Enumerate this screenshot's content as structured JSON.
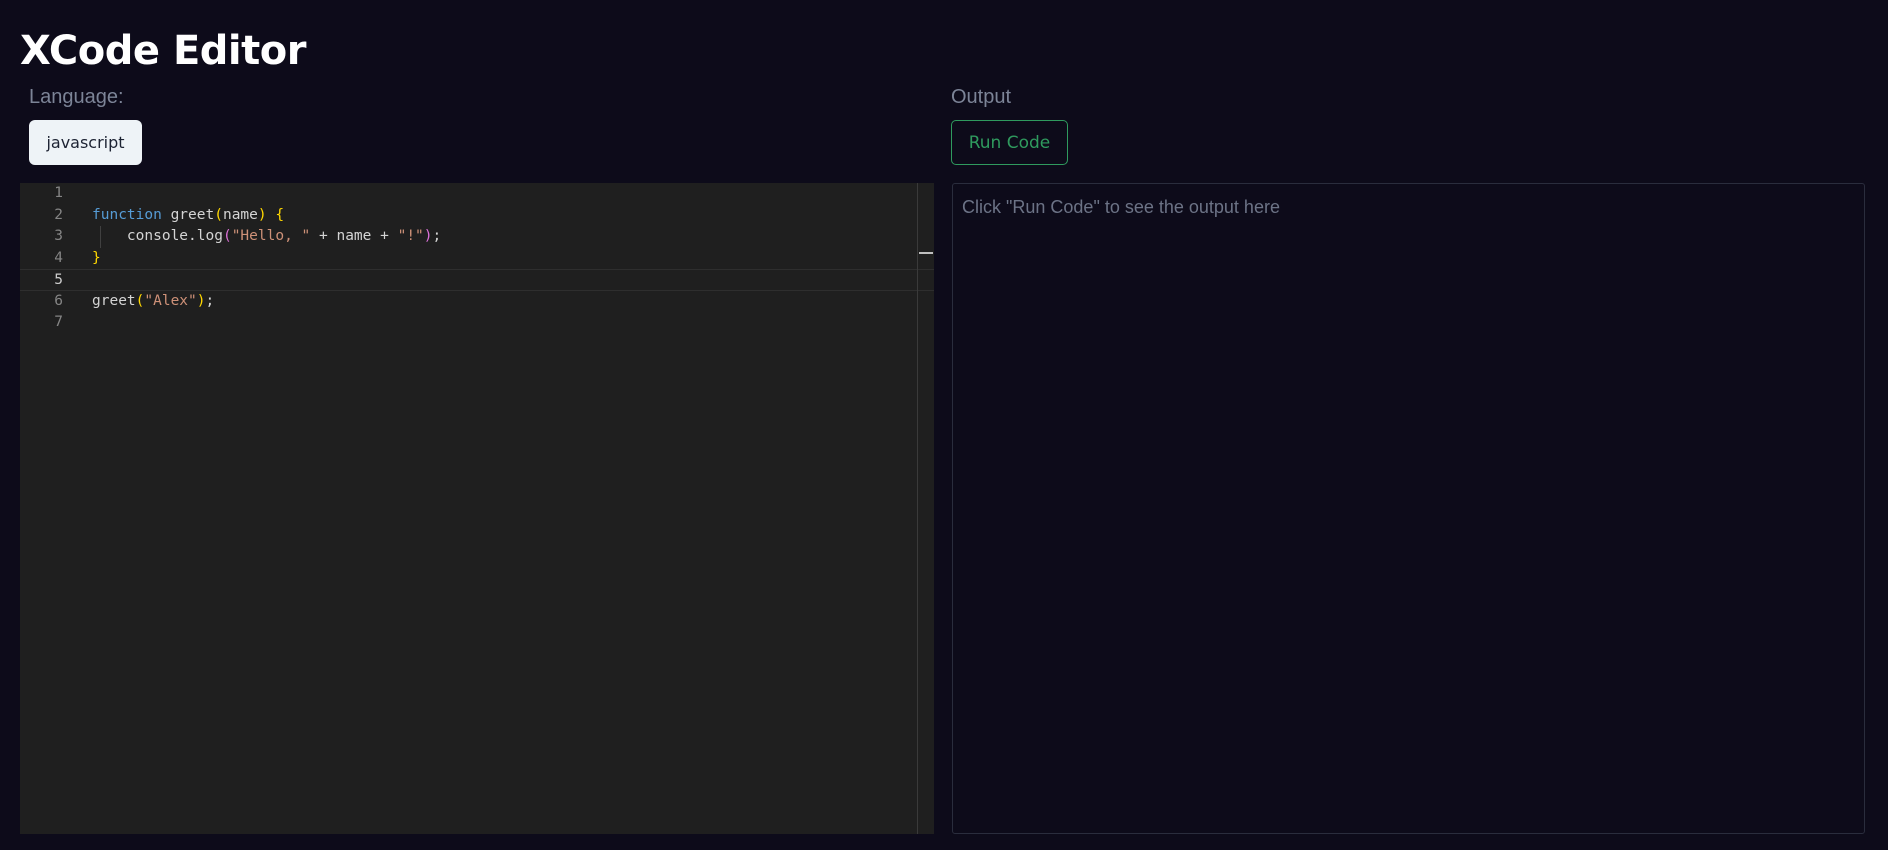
{
  "app": {
    "title": "XCode Editor"
  },
  "language": {
    "label": "Language:",
    "selected": "javascript"
  },
  "output": {
    "label": "Output",
    "run_button": "Run Code",
    "placeholder": "Click \"Run Code\" to see the output here"
  },
  "editor": {
    "active_line": 5,
    "line_numbers": [
      "1",
      "2",
      "3",
      "4",
      "5",
      "6",
      "7"
    ],
    "lines": [
      "",
      "function greet(name) {",
      "    console.log(\"Hello, \" + name + \"!\");",
      "}",
      "",
      "greet(\"Alex\");",
      ""
    ]
  },
  "colors": {
    "background": "#0d0b1a",
    "editor_background": "#1f1f1f",
    "run_button_accent": "#2f9a5e",
    "language_button_bg": "#eef3f7"
  }
}
